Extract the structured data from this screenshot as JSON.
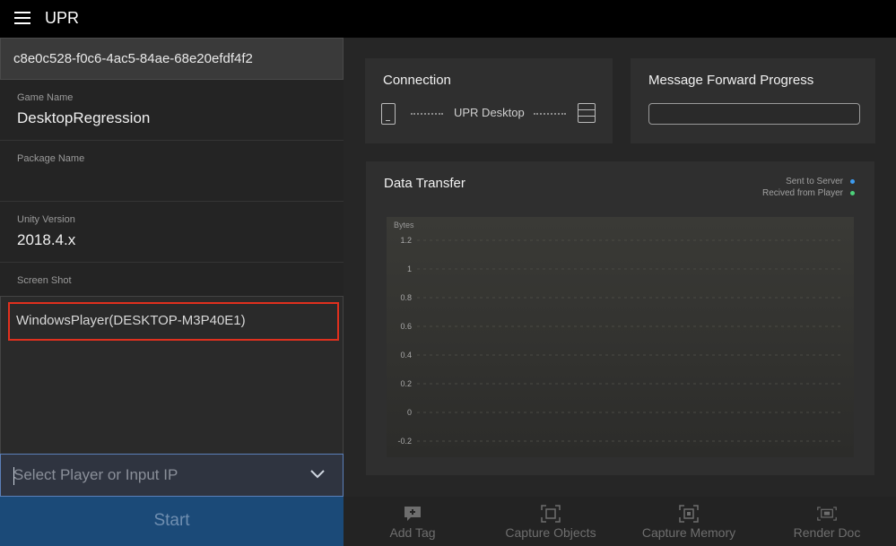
{
  "app": {
    "title": "UPR"
  },
  "device": {
    "id": "c8e0c528-f0c6-4ac5-84ae-68e20efdf4f2"
  },
  "fields": [
    {
      "label": "Game Name",
      "value": "DesktopRegression"
    },
    {
      "label": "Package Name",
      "value": ""
    },
    {
      "label": "Unity Version",
      "value": "2018.4.x"
    },
    {
      "label": "Screen Shot",
      "value": ""
    }
  ],
  "players": {
    "items": [
      "WindowsPlayer(DESKTOP-M3P40E1)"
    ]
  },
  "select": {
    "placeholder": "Select Player or Input IP"
  },
  "start": {
    "label": "Start"
  },
  "connection": {
    "title": "Connection",
    "target": "UPR Desktop"
  },
  "forward": {
    "title": "Message Forward Progress",
    "progress": 0
  },
  "transfer": {
    "title": "Data Transfer",
    "legend": [
      {
        "name": "Sent to Server",
        "color": "#3d9cf0"
      },
      {
        "name": "Recived from Player",
        "color": "#4cd17a"
      }
    ]
  },
  "chart_data": {
    "type": "line",
    "ylabel": "Bytes",
    "yticks": [
      "1.2",
      "1",
      "0.8",
      "0.6",
      "0.4",
      "0.2",
      "0",
      "-0.2"
    ],
    "ylim": [
      -0.2,
      1.2
    ],
    "series": [
      {
        "name": "Sent to Server",
        "values": []
      },
      {
        "name": "Recived from Player",
        "values": []
      }
    ],
    "grid": true,
    "legend_position": "top-right"
  },
  "toolbar": {
    "items": [
      {
        "label": "Add Tag",
        "icon": "add-tag-icon"
      },
      {
        "label": "Capture Objects",
        "icon": "capture-objects-icon"
      },
      {
        "label": "Capture Memory",
        "icon": "capture-memory-icon"
      },
      {
        "label": "Render Doc",
        "icon": "render-doc-icon"
      }
    ]
  }
}
